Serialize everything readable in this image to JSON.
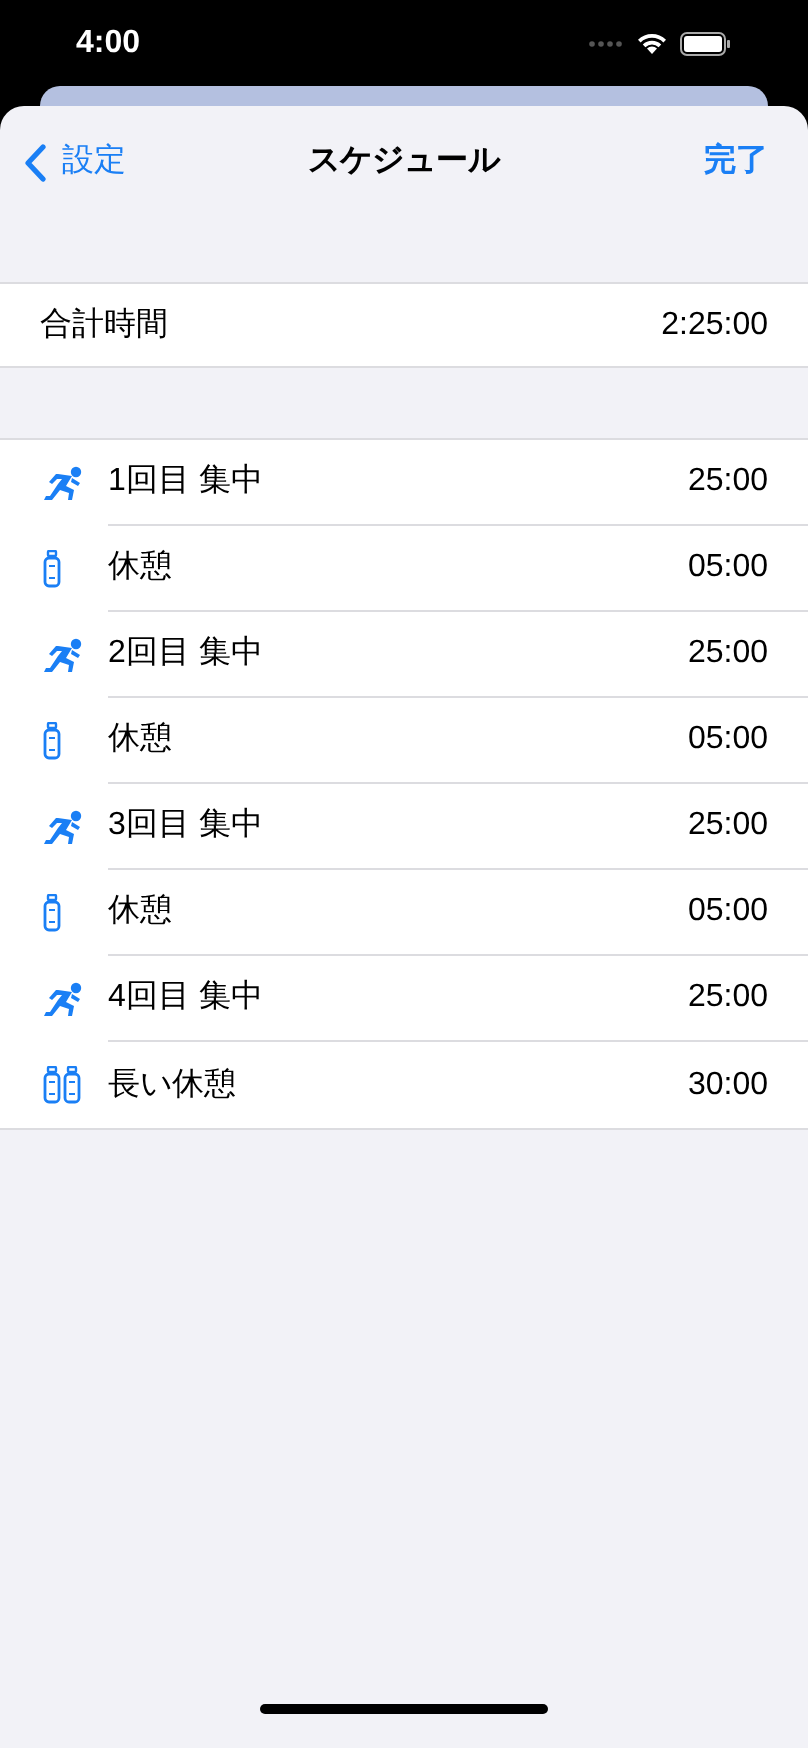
{
  "status_bar": {
    "time": "4:00"
  },
  "nav": {
    "back": "設定",
    "title": "スケジュール",
    "done": "完了"
  },
  "total": {
    "label": "合計時間",
    "value": "2:25:00"
  },
  "schedule": [
    {
      "kind": "focus",
      "label": "1回目 集中",
      "duration": "25:00"
    },
    {
      "kind": "break",
      "label": "休憩",
      "duration": "05:00"
    },
    {
      "kind": "focus",
      "label": "2回目 集中",
      "duration": "25:00"
    },
    {
      "kind": "break",
      "label": "休憩",
      "duration": "05:00"
    },
    {
      "kind": "focus",
      "label": "3回目 集中",
      "duration": "25:00"
    },
    {
      "kind": "break",
      "label": "休憩",
      "duration": "05:00"
    },
    {
      "kind": "focus",
      "label": "4回目 集中",
      "duration": "25:00"
    },
    {
      "kind": "long_break",
      "label": "長い休憩",
      "duration": "30:00"
    }
  ]
}
